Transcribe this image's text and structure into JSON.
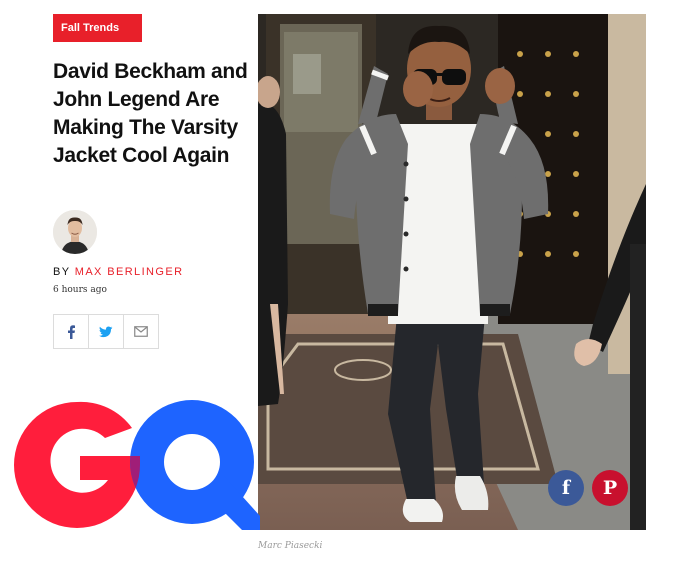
{
  "article": {
    "category": "Fall Trends",
    "headline": "David Beckham and John Legend Are Making The Varsity Jacket Cool Again",
    "byline_prefix": "BY",
    "author": "MAX BERLINGER",
    "published": "6 hours ago"
  },
  "share_bar": {
    "buttons": [
      {
        "icon": "facebook-icon",
        "color": "#3b5998"
      },
      {
        "icon": "twitter-icon",
        "color": "#1da1f2"
      },
      {
        "icon": "email-icon",
        "color": "#888888"
      }
    ]
  },
  "logo": {
    "text": "GQ",
    "colors": {
      "g": "#ff1e3c",
      "q": "#1e64ff",
      "overlap": "#a01e78"
    }
  },
  "photo": {
    "credit": "Marc Piasecki",
    "share": {
      "facebook_glyph": "f",
      "pinterest_glyph": "P",
      "facebook_color": "#3b5998",
      "pinterest_color": "#c8102e"
    }
  },
  "colors": {
    "accent": "#e8202a"
  }
}
